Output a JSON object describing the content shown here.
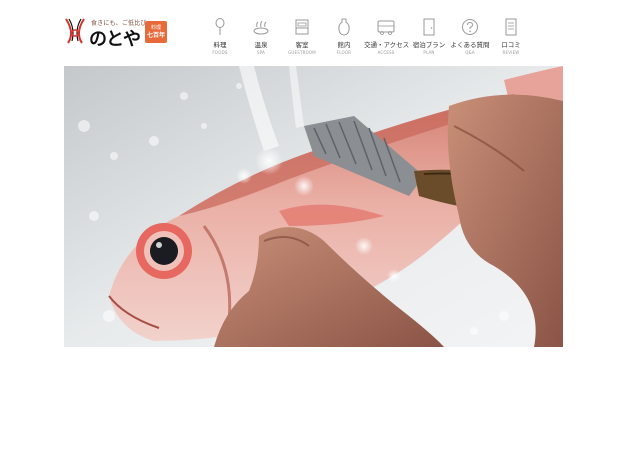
{
  "header": {
    "logo": {
      "tagline": "食きにも、ご低比び",
      "name": "のとや",
      "badge_line1": "料理",
      "badge_line2": "七百年"
    },
    "nav": [
      {
        "label_ja": "料理",
        "label_en": "FOODS",
        "icon": "spoon-icon"
      },
      {
        "label_ja": "温泉",
        "label_en": "SPA",
        "icon": "hot-spring-icon"
      },
      {
        "label_ja": "客室",
        "label_en": "GUESTROOM",
        "icon": "bed-icon"
      },
      {
        "label_ja": "館内",
        "label_en": "FLOOR",
        "icon": "vase-icon"
      },
      {
        "label_ja": "交通・アクセス",
        "label_en": "ACCESS",
        "icon": "bus-icon"
      },
      {
        "label_ja": "宿泊プラン",
        "label_en": "PLAN",
        "icon": "door-icon"
      },
      {
        "label_ja": "よくある質問",
        "label_en": "Q&A",
        "icon": "question-icon"
      },
      {
        "label_ja": "口コミ",
        "label_en": "REVIEW",
        "icon": "note-icon"
      }
    ]
  },
  "hero": {
    "image": "red-fish-being-scaled-under-water",
    "colors": {
      "fish": "#e9a79c",
      "fish_dark": "#c86a5a",
      "water": "#eef1f2"
    }
  }
}
